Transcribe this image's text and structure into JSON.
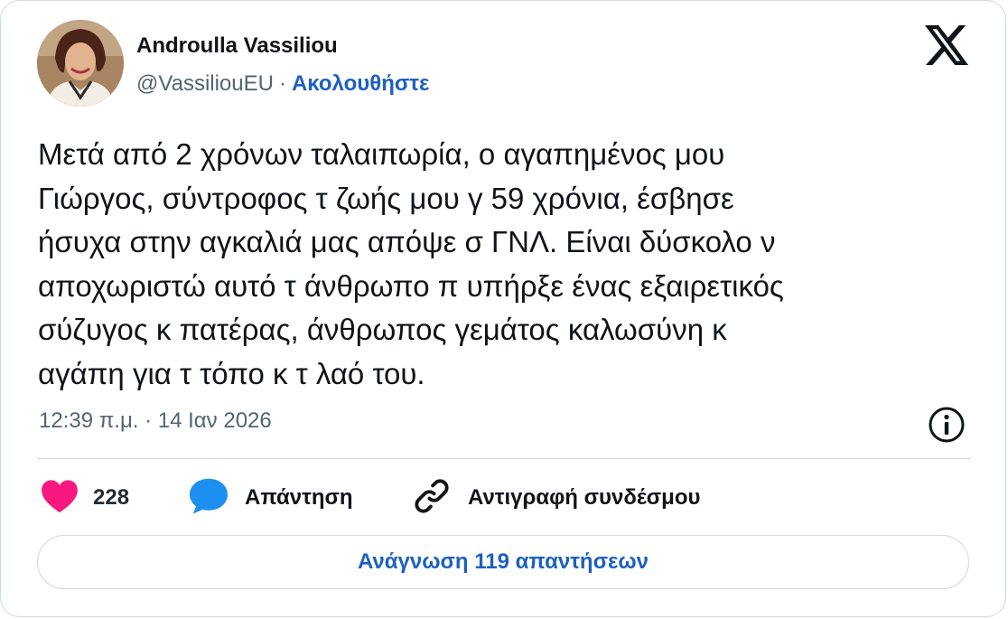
{
  "author": {
    "name": "Androulla Vassiliou",
    "handle": "@VassiliouEU",
    "separator": "·",
    "follow_label": "Ακολουθήστε"
  },
  "icons": {
    "brand": "x-logo-icon",
    "info": "info-icon",
    "like": "heart-icon",
    "reply": "speech-bubble-icon",
    "copy": "link-icon"
  },
  "tweet": {
    "text": "Μετά από 2 χρόνων ταλαιπωρία, ο αγαπημένος μου\nΓιώργος, σύντροφος τ ζωής μου γ  59 χρόνια, έσβησε\nήσυχα στην αγκαλιά μας απόψε σ  ΓΝΛ. Είναι δύσκολο ν\nαποχωριστώ αυτό τ άνθρωπο π υπήρξε ένας εξαιρετικός\nσύζυγος κ πατέρας, άνθρωπος γεμάτος καλωσύνη κ\nαγάπη για τ τόπο κ τ λαό του.",
    "timestamp": "12:39 π.μ. · 14 Ιαν 2026"
  },
  "actions": {
    "like_count": "228",
    "reply_label": "Απάντηση",
    "copy_link_label": "Αντιγραφή συνδέσμου"
  },
  "read_replies_label": "Ανάγνωση 119 απαντήσεων",
  "colors": {
    "accent": "#1d60c0",
    "heart": "#f91880",
    "reply_icon": "#1d8ff0",
    "text": "#0f1419",
    "muted": "#536471",
    "border": "#cfd9de"
  }
}
